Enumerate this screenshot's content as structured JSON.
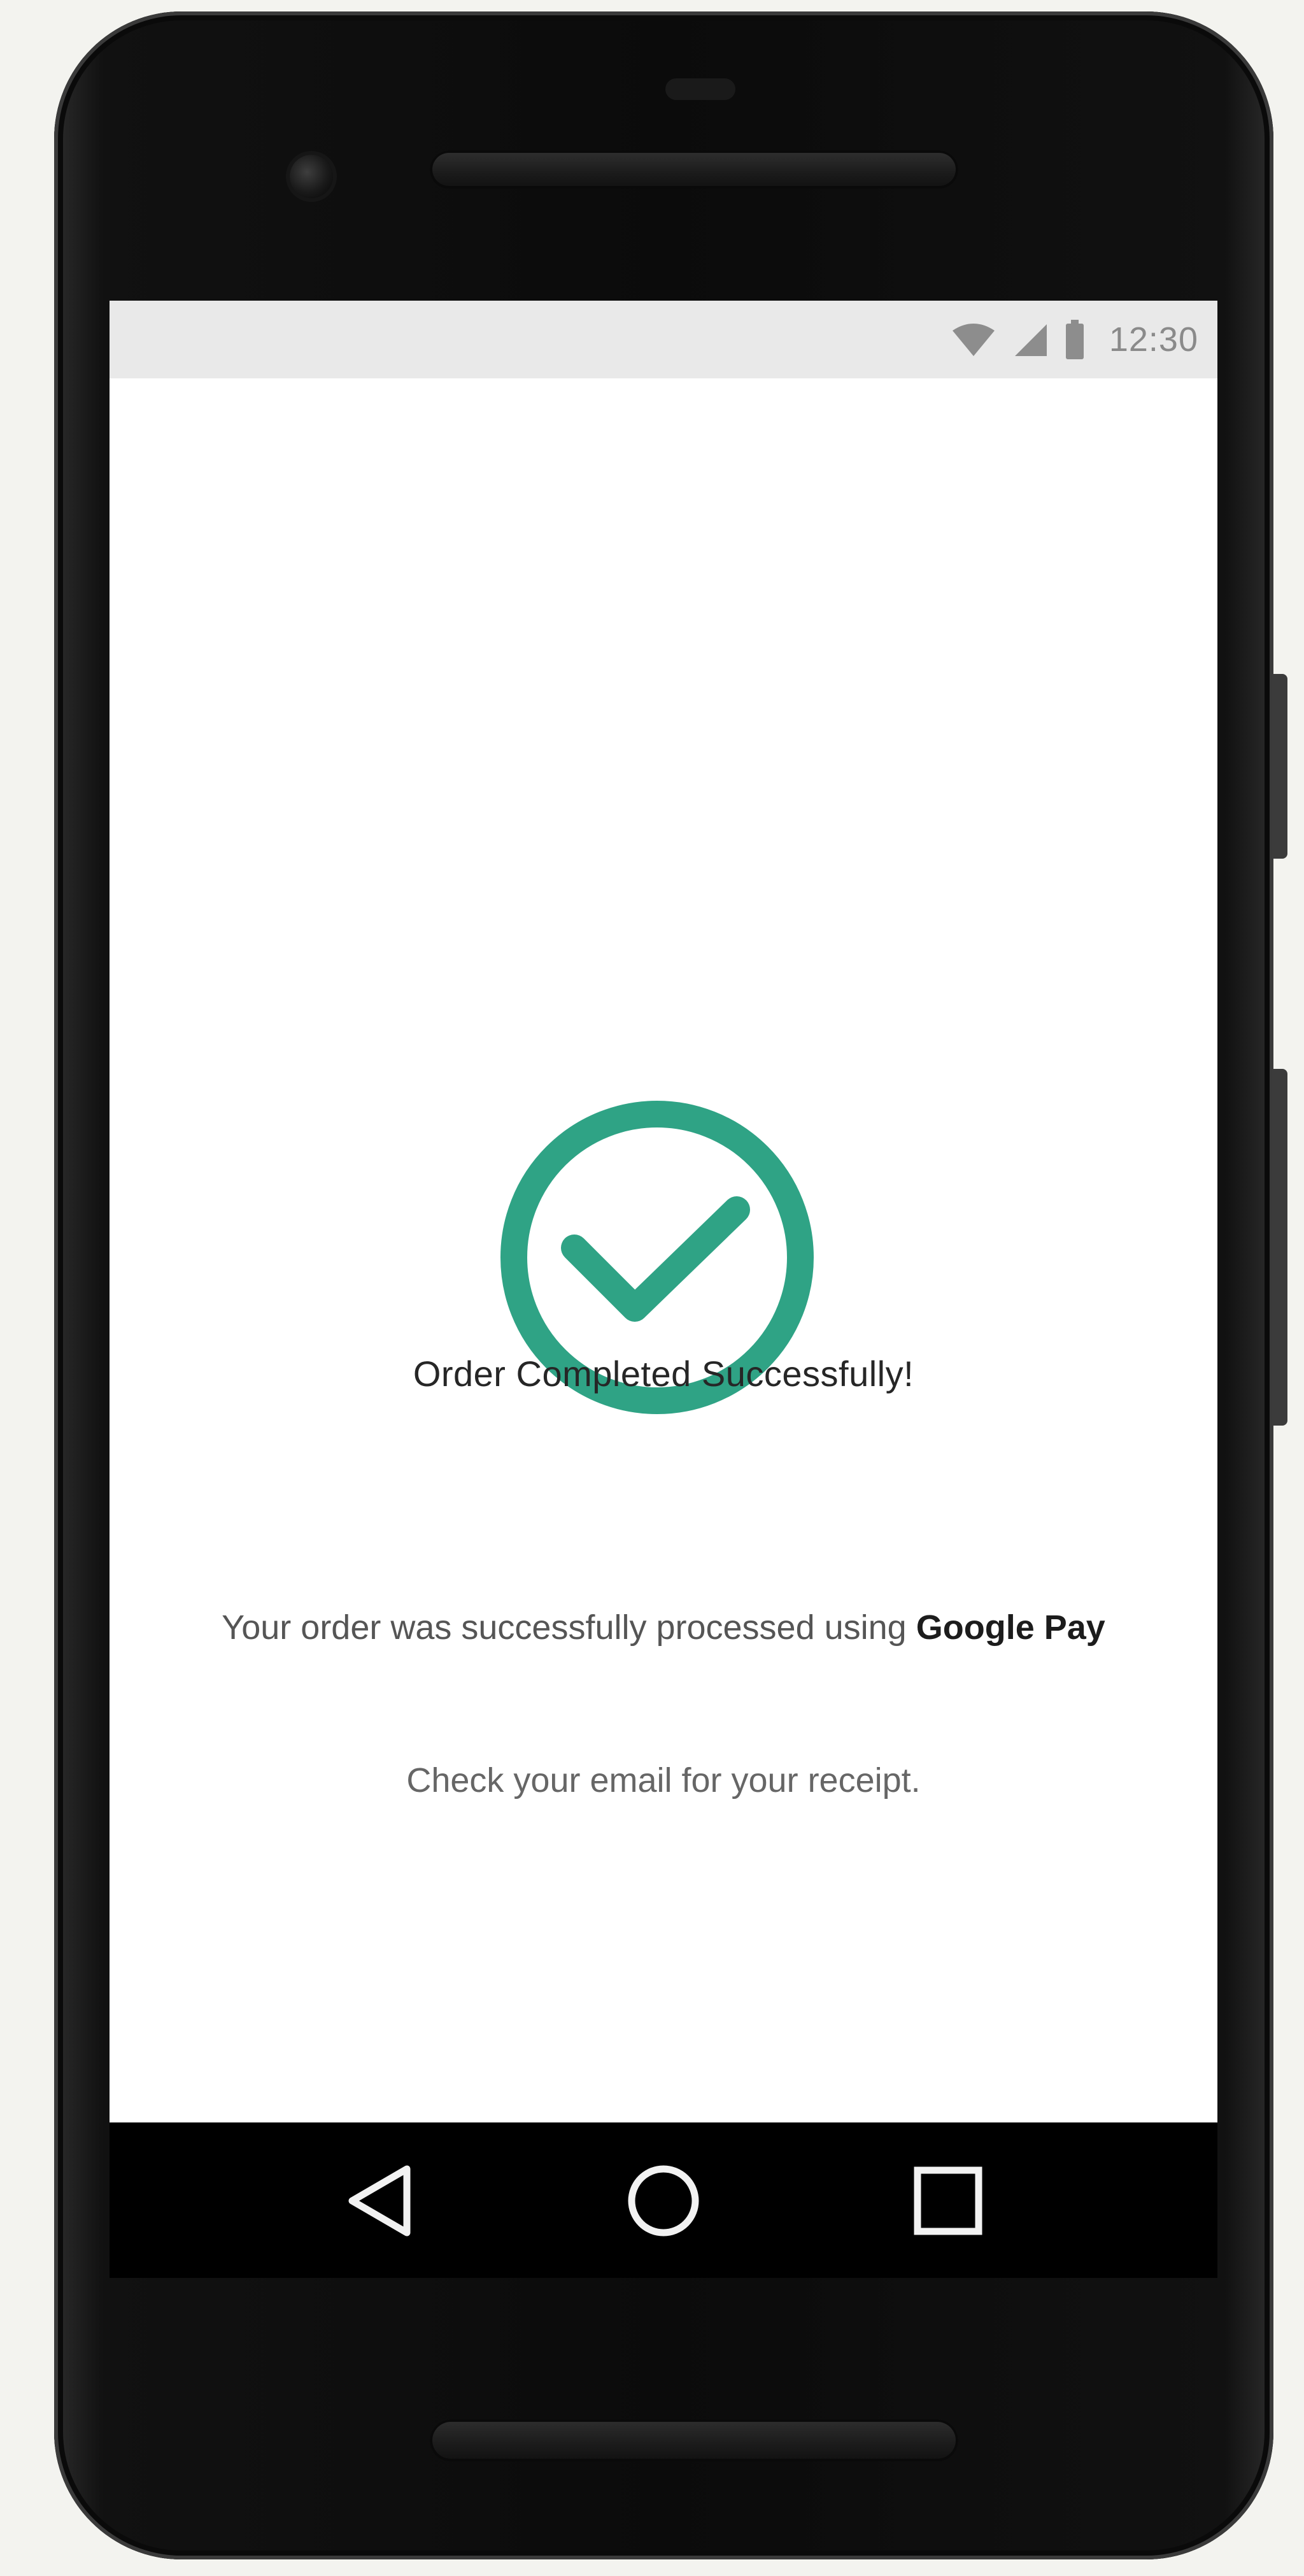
{
  "status_bar": {
    "time": "12:30",
    "icons": [
      "wifi-icon",
      "cellular-signal-icon",
      "battery-icon"
    ]
  },
  "confirmation": {
    "icon": "check-circle-icon",
    "icon_color": "#2fa385",
    "title": "Order Completed Successfully!",
    "description_prefix": "Your order was successfully processed using",
    "payment_method": "Google Pay",
    "note": "Check your email for your receipt."
  },
  "navigation": {
    "back_icon": "back-triangle-icon",
    "home_icon": "home-circle-icon",
    "recents_icon": "recents-square-icon"
  }
}
